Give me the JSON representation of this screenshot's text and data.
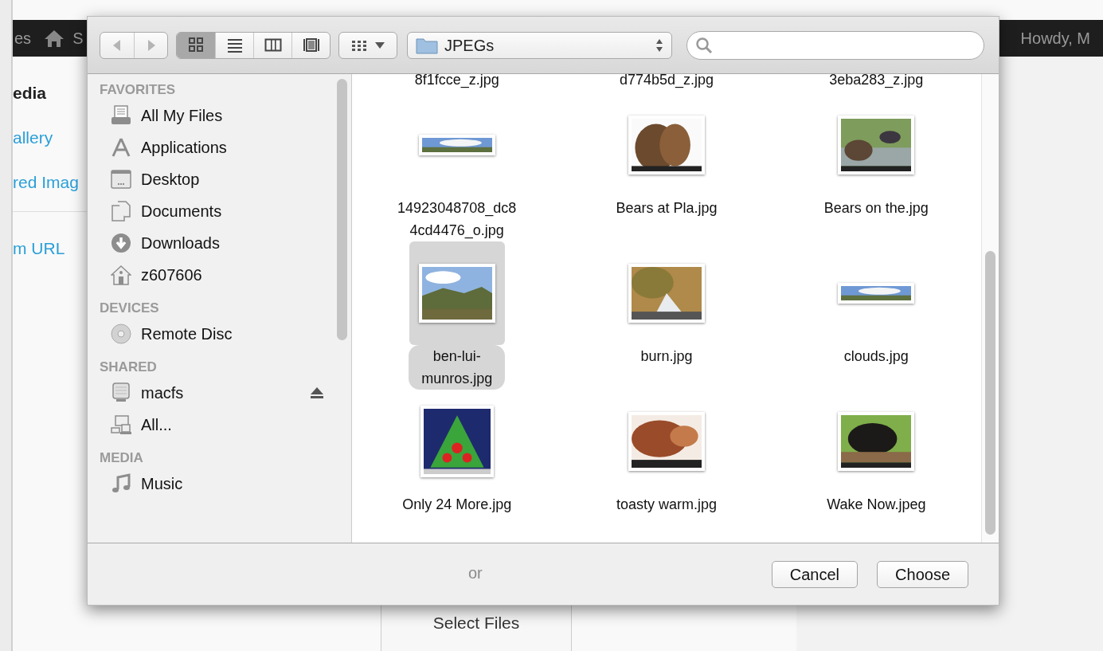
{
  "background_page": {
    "admin_bar": {
      "left_text": "es",
      "site_initial": "S",
      "greeting": "Howdy, M"
    },
    "menu": [
      {
        "label": "edia",
        "kind": "heading"
      },
      {
        "label": "allery",
        "kind": "link"
      },
      {
        "label": "red Imag",
        "kind": "link"
      },
      {
        "label": "m URL",
        "kind": "link"
      }
    ],
    "separator_text": "or",
    "select_button": "Select Files"
  },
  "dialog": {
    "toolbar": {
      "back_enabled": false,
      "forward_enabled": false,
      "views": [
        {
          "selected": true
        },
        {
          "selected": false
        },
        {
          "selected": false
        },
        {
          "selected": false
        }
      ],
      "path": "JPEGs"
    },
    "sidebar": [
      {
        "title": "FAVORITES",
        "items": [
          {
            "label": "All My Files",
            "ejectable": false
          },
          {
            "label": "Applications",
            "ejectable": false
          },
          {
            "label": "Desktop",
            "ejectable": false
          },
          {
            "label": "Documents",
            "ejectable": false
          },
          {
            "label": "Downloads",
            "ejectable": false
          },
          {
            "label": "z607606",
            "ejectable": false
          }
        ]
      },
      {
        "title": "DEVICES",
        "items": [
          {
            "label": "Remote Disc",
            "ejectable": false
          }
        ]
      },
      {
        "title": "SHARED",
        "items": [
          {
            "label": "macfs",
            "ejectable": true
          },
          {
            "label": "All...",
            "ejectable": false
          }
        ]
      },
      {
        "title": "MEDIA",
        "items": [
          {
            "label": "Music",
            "ejectable": false
          }
        ]
      }
    ],
    "partial_labels": [
      "8f1fcce_z.jpg",
      "d774b5d_z.jpg",
      "3eba283_z.jpg"
    ],
    "files": [
      {
        "name": "14923048708_dc8\n4cd4476_o.jpg",
        "kind": "panorama",
        "selected": false
      },
      {
        "name": "Bears at Pla.jpg",
        "kind": "landscape",
        "selected": false
      },
      {
        "name": "Bears on the.jpg",
        "kind": "landscape",
        "selected": false
      },
      {
        "name": "ben-lui-\nmunros.jpg",
        "kind": "landscape",
        "selected": true
      },
      {
        "name": "burn.jpg",
        "kind": "landscape",
        "selected": false
      },
      {
        "name": "clouds.jpg",
        "kind": "panorama",
        "selected": false
      },
      {
        "name": "Only 24 More.jpg",
        "kind": "square",
        "selected": false
      },
      {
        "name": "toasty warm.jpg",
        "kind": "landscape",
        "selected": false
      },
      {
        "name": "Wake Now.jpeg",
        "kind": "landscape",
        "selected": false
      }
    ],
    "buttons": [
      "Cancel",
      "Choose"
    ]
  }
}
